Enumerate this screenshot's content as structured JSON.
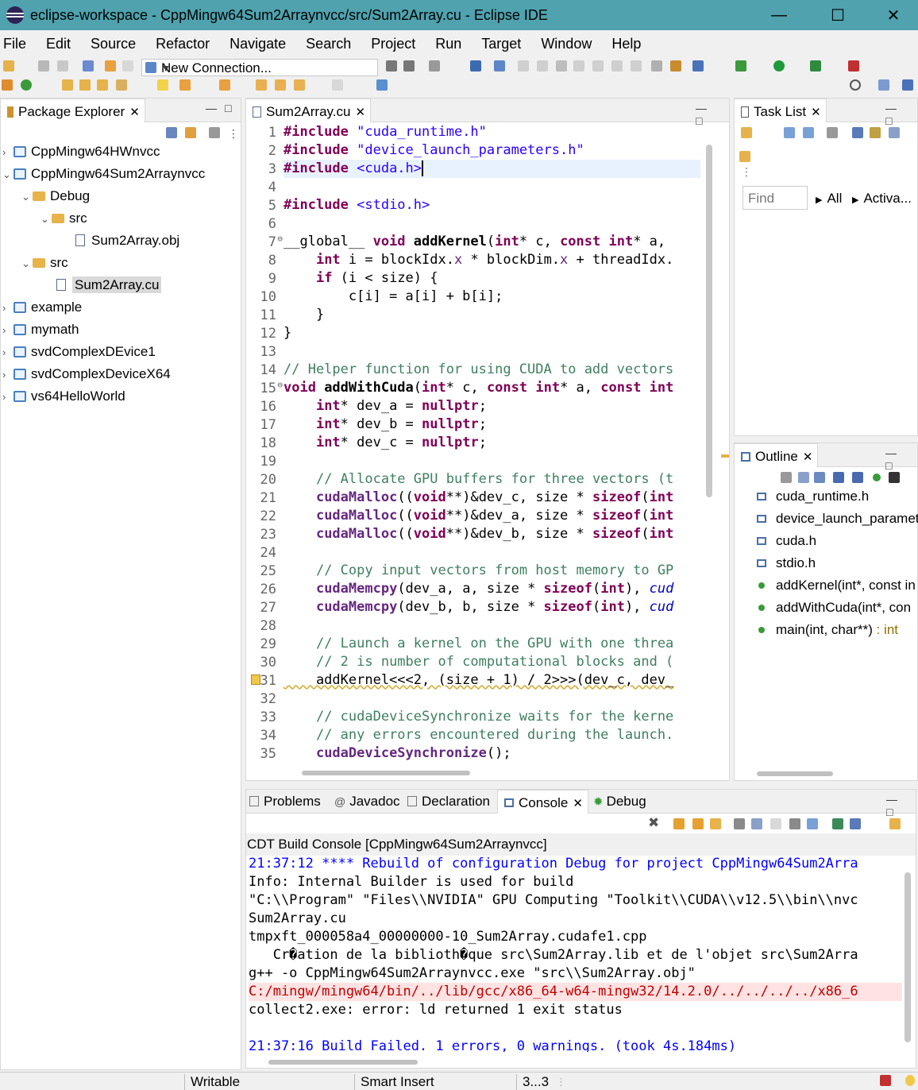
{
  "window": {
    "title": "eclipse-workspace - CppMingw64Sum2Arraynvcc/src/Sum2Array.cu - Eclipse IDE"
  },
  "menu": [
    "File",
    "Edit",
    "Source",
    "Refactor",
    "Navigate",
    "Search",
    "Project",
    "Run",
    "Target",
    "Window",
    "Help"
  ],
  "toolbar": {
    "connection": "New Connection..."
  },
  "package_explorer": {
    "tab": "Package Explorer",
    "items": [
      {
        "label": "CppMingw64HWnvcc",
        "depth": 0,
        "chevron": "›",
        "icon": "project"
      },
      {
        "label": "CppMingw64Sum2Arraynvcc",
        "depth": 0,
        "chevron": "⌄",
        "icon": "project"
      },
      {
        "label": "Debug",
        "depth": 1,
        "chevron": "⌄",
        "icon": "folder"
      },
      {
        "label": "src",
        "depth": 2,
        "chevron": "⌄",
        "icon": "folder"
      },
      {
        "label": "Sum2Array.obj",
        "depth": 3,
        "chevron": "",
        "icon": "file"
      },
      {
        "label": "src",
        "depth": 1,
        "chevron": "⌄",
        "icon": "folder"
      },
      {
        "label": "Sum2Array.cu",
        "depth": 2,
        "chevron": "",
        "icon": "file",
        "selected": true
      },
      {
        "label": "example",
        "depth": 0,
        "chevron": "›",
        "icon": "project"
      },
      {
        "label": "mymath",
        "depth": 0,
        "chevron": "›",
        "icon": "project"
      },
      {
        "label": "svdComplexDEvice1",
        "depth": 0,
        "chevron": "›",
        "icon": "project"
      },
      {
        "label": "svdComplexDeviceX64",
        "depth": 0,
        "chevron": "›",
        "icon": "project"
      },
      {
        "label": "vs64HelloWorld",
        "depth": 0,
        "chevron": "›",
        "icon": "project"
      }
    ]
  },
  "editor": {
    "tab": "Sum2Array.cu",
    "lines": [
      [
        [
          "kw",
          "#include "
        ],
        [
          "str",
          "\"cuda_runtime.h\""
        ]
      ],
      [
        [
          "kw",
          "#include "
        ],
        [
          "str",
          "\"device_launch_parameters.h\""
        ]
      ],
      [
        [
          "kw",
          "#include "
        ],
        [
          "str",
          "<cuda.h>"
        ]
      ],
      [],
      [
        [
          "kw",
          "#include "
        ],
        [
          "str",
          "<stdio.h>"
        ]
      ],
      [],
      [
        [
          "",
          "__global__ "
        ],
        [
          "kw",
          "void "
        ],
        [
          "fn",
          "addKernel"
        ],
        [
          "",
          "("
        ],
        [
          "kw",
          "int"
        ],
        [
          "",
          "* c, "
        ],
        [
          "kw",
          "const int"
        ],
        [
          "",
          "* a, "
        ]
      ],
      [
        [
          "",
          "    "
        ],
        [
          "kw",
          "int"
        ],
        [
          "",
          " i = blockIdx."
        ],
        [
          "mac",
          "x"
        ],
        [
          "",
          "",
          " * blockDim."
        ],
        [
          "mac",
          "x"
        ],
        [
          "",
          "",
          " + threadIdx."
        ]
      ],
      [
        [
          "",
          "    "
        ],
        [
          "kw",
          "if"
        ],
        [
          "",
          " (i < size) {"
        ]
      ],
      [
        [
          "",
          "        c[i] = a[i] + b[i];"
        ]
      ],
      [
        [
          "",
          "    }"
        ]
      ],
      [
        [
          "",
          "}"
        ]
      ],
      [],
      [
        [
          "cm",
          "// Helper function for using CUDA to add vectors"
        ]
      ],
      [
        [
          "kw",
          "void "
        ],
        [
          "fn",
          "addWithCuda"
        ],
        [
          "",
          "("
        ],
        [
          "kw",
          "int"
        ],
        [
          "",
          "* c, "
        ],
        [
          "kw",
          "const int"
        ],
        [
          "",
          "* a, "
        ],
        [
          "kw",
          "const int"
        ]
      ],
      [
        [
          "",
          "    "
        ],
        [
          "kw",
          "int"
        ],
        [
          "",
          "* dev_a = "
        ],
        [
          "kw",
          "nullptr"
        ],
        [
          "",
          ";"
        ]
      ],
      [
        [
          "",
          "    "
        ],
        [
          "kw",
          "int"
        ],
        [
          "",
          "* dev_b = "
        ],
        [
          "kw",
          "nullptr"
        ],
        [
          "",
          ";"
        ]
      ],
      [
        [
          "",
          "    "
        ],
        [
          "kw",
          "int"
        ],
        [
          "",
          "* dev_c = "
        ],
        [
          "kw",
          "nullptr"
        ],
        [
          "",
          ";"
        ]
      ],
      [],
      [
        [
          "",
          "    "
        ],
        [
          "cm",
          "// Allocate GPU buffers for three vectors (t"
        ]
      ],
      [
        [
          "",
          "    "
        ],
        [
          "fnc",
          "cudaMalloc"
        ],
        [
          "",
          "(("
        ],
        [
          "kw",
          "void"
        ],
        [
          "",
          "**)&dev_c, size * "
        ],
        [
          "kw",
          "sizeof"
        ],
        [
          "",
          "("
        ],
        [
          "kw",
          "int"
        ]
      ],
      [
        [
          "",
          "    "
        ],
        [
          "fnc",
          "cudaMalloc"
        ],
        [
          "",
          "(("
        ],
        [
          "kw",
          "void"
        ],
        [
          "",
          "**)&dev_a, size * "
        ],
        [
          "kw",
          "sizeof"
        ],
        [
          "",
          "("
        ],
        [
          "kw",
          "int"
        ]
      ],
      [
        [
          "",
          "    "
        ],
        [
          "fnc",
          "cudaMalloc"
        ],
        [
          "",
          "(("
        ],
        [
          "kw",
          "void"
        ],
        [
          "",
          "**)&dev_b, size * "
        ],
        [
          "kw",
          "sizeof"
        ],
        [
          "",
          "("
        ],
        [
          "kw",
          "int"
        ]
      ],
      [],
      [
        [
          "",
          "    "
        ],
        [
          "cm",
          "// Copy input vectors from host memory to GP"
        ]
      ],
      [
        [
          "",
          "    "
        ],
        [
          "fnc",
          "cudaMemcpy"
        ],
        [
          "",
          "(dev_a, a, size * "
        ],
        [
          "kw",
          "sizeof"
        ],
        [
          "",
          "("
        ],
        [
          "kw",
          "int"
        ],
        [
          "",
          "), "
        ],
        [
          "it",
          "cud"
        ]
      ],
      [
        [
          "",
          "    "
        ],
        [
          "fnc",
          "cudaMemcpy"
        ],
        [
          "",
          "(dev_b, b, size * "
        ],
        [
          "kw",
          "sizeof"
        ],
        [
          "",
          "("
        ],
        [
          "kw",
          "int"
        ],
        [
          "",
          "), "
        ],
        [
          "it",
          "cud"
        ]
      ],
      [],
      [
        [
          "",
          "    "
        ],
        [
          "cm",
          "// Launch a kernel on the GPU with one threa"
        ]
      ],
      [
        [
          "",
          "    "
        ],
        [
          "cm",
          "// 2 is number of computational blocks and ("
        ]
      ],
      [
        [
          "",
          "    addKernel<<<2, (size + 1) / 2>>>(dev_c, dev_"
        ]
      ],
      [],
      [
        [
          "",
          "    "
        ],
        [
          "cm",
          "// cudaDeviceSynchronize waits for the kerne"
        ]
      ],
      [
        [
          "",
          "    "
        ],
        [
          "cm",
          "// any errors encountered during the launch."
        ]
      ],
      [
        [
          "",
          "    "
        ],
        [
          "fnc",
          "cudaDeviceSynchronize"
        ],
        [
          "",
          "();"
        ]
      ]
    ]
  },
  "tasklist": {
    "tab": "Task List",
    "find_placeholder": "Find",
    "all": "All",
    "activate": "Activa..."
  },
  "outline": {
    "tab": "Outline",
    "items": [
      {
        "label": "cuda_runtime.h",
        "type": "include"
      },
      {
        "label": "device_launch_paramete",
        "type": "include"
      },
      {
        "label": "cuda.h",
        "type": "include"
      },
      {
        "label": "stdio.h",
        "type": "include"
      },
      {
        "label": "addKernel(int*, const in",
        "type": "function"
      },
      {
        "label": "addWithCuda(int*, con",
        "type": "function"
      },
      {
        "label": "main(int, char**)",
        "ret": " : int",
        "type": "function"
      }
    ]
  },
  "bottom_tabs": [
    "Problems",
    "Javadoc",
    "Declaration",
    "Console",
    "Debug"
  ],
  "console": {
    "header": "CDT Build Console [CppMingw64Sum2Arraynvcc]",
    "lines": [
      {
        "text": "21:37:12 **** Rebuild of configuration Debug for project CppMingw64Sum2Arra",
        "style": "blue"
      },
      {
        "text": "Info: Internal Builder is used for build",
        "style": ""
      },
      {
        "text": "\"C:\\\\Program\" \"Files\\\\NVIDIA\" GPU Computing \"Toolkit\\\\CUDA\\\\v12.5\\\\bin\\\\nvc",
        "style": ""
      },
      {
        "text": "Sum2Array.cu",
        "style": ""
      },
      {
        "text": "tmpxft_000058a4_00000000-10_Sum2Array.cudafe1.cpp",
        "style": ""
      },
      {
        "text": "   Cr�ation de la biblioth�que src\\Sum2Array.lib et de l'objet src\\Sum2Arra",
        "style": ""
      },
      {
        "text": "g++ -o CppMingw64Sum2Arraynvcc.exe \"src\\\\Sum2Array.obj\"",
        "style": ""
      },
      {
        "text": "C:/mingw/mingw64/bin/../lib/gcc/x86_64-w64-mingw32/14.2.0/../../../../x86_6",
        "style": "err"
      },
      {
        "text": "collect2.exe: error: ld returned 1 exit status",
        "style": ""
      },
      {
        "text": "",
        "style": ""
      },
      {
        "text": "21:37:16 Build Failed. 1 errors, 0 warnings. (took 4s.184ms)",
        "style": "blue"
      }
    ]
  },
  "status": {
    "writable": "Writable",
    "insert": "Smart Insert",
    "position": "3...3"
  }
}
